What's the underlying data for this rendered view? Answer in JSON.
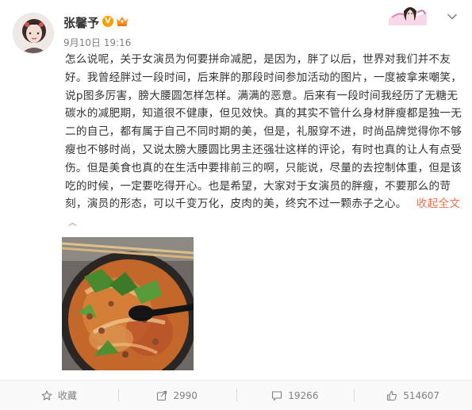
{
  "post": {
    "username": "张馨予",
    "verified_mark": "V",
    "time": "9月10日 19:16",
    "text": "怎么说呢，关于女演员为何要拼命减肥，是因为，胖了以后，世界对我们并不友好。我曾经胖过一段时间，后来胖的那段时间参加活动的图片，一度被拿来嘲笑，说p图多厉害，膀大腰圆怎样怎样。满满的恶意。后来有一段时间我经历了无糖无碳水的减肥期，知道很不健康，但见效快。真的其实不管什么身材胖瘦都是独一无二的自己，都有属于自己不同时期的美，但是，礼服穿不进，时尚品牌觉得你不够瘦也不够时尚，又说太膀大腰圆比男主还强壮这样的评论，有时也真的让人有点受伤。但是美食也真的在生活中要排前三的啊，只能说，尽量的去控制体重，但是该吃的时候，一定要吃得开心。也是希望，大家对于女演员的胖瘦，不要那么的苛刻，演员的形态，可以千变万化，皮肉的美，终究不过一颗赤子之心。",
    "collapse_label": "收起全文"
  },
  "actions": {
    "favorite_label": "收藏",
    "repost_count": "2990",
    "comment_count": "19266",
    "like_count": "514607"
  },
  "colors": {
    "link": "#eb7350",
    "meta_text": "#808080",
    "verified_badge": "#f7a000",
    "action_bar_bg": "#f9f9f9"
  },
  "icons": [
    "avatar-image",
    "verified-icon",
    "vip-crown-icon",
    "decorative-figure-icon",
    "chevron-down-icon",
    "collapse-arrow-icon",
    "star-icon",
    "repost-icon",
    "comment-icon",
    "like-icon"
  ]
}
